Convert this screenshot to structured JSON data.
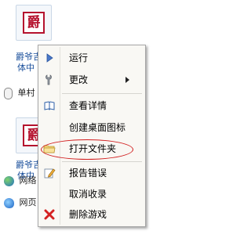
{
  "background_items": {
    "tile_top_name": [
      "爵爷吉",
      "体中"
    ],
    "tile_bottom_name": [
      "爵爷吉",
      "体中"
    ],
    "mouse_label": "单村",
    "web_link_1": "网络",
    "web_link_2": "网页"
  },
  "context_menu": {
    "items": [
      {
        "label": "运行",
        "icon": "play-icon"
      },
      {
        "label": "更改",
        "icon": "wrench-icon",
        "has_submenu": true
      },
      {
        "label": "查看详情",
        "icon": "book-icon"
      },
      {
        "label": "创建桌面图标",
        "icon": ""
      },
      {
        "label": "打开文件夹",
        "icon": "folder-icon"
      },
      {
        "label": "报告错误",
        "icon": "pencil-icon"
      },
      {
        "label": "取消收录",
        "icon": ""
      },
      {
        "label": "删除游戏",
        "icon": "red-x-icon"
      }
    ]
  },
  "colors": {
    "menu_bg": "#f9f8f4",
    "highlight_ring": "#d11d1d",
    "tile_name": "#1a4f9b"
  }
}
